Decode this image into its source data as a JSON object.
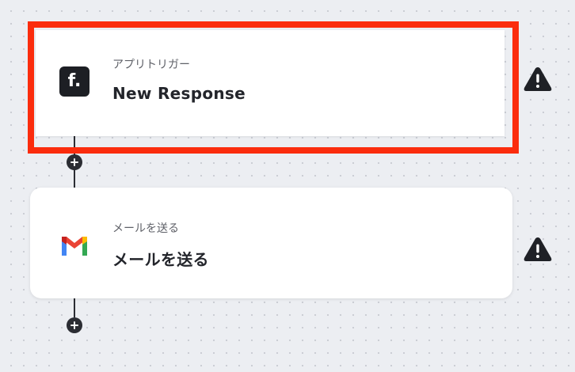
{
  "flow": {
    "steps": [
      {
        "icon": "formbricks-icon",
        "sublabel": "アプリトリガー",
        "title": "New Response",
        "selected": true,
        "warning": true
      },
      {
        "icon": "gmail-icon",
        "sublabel": "メールを送る",
        "title": "メールを送る",
        "selected": false,
        "warning": true
      }
    ],
    "formbricks_glyph": "f."
  },
  "colors": {
    "canvas_bg": "#eceef2",
    "highlight": "#fb2c0d",
    "connector": "#2b2d33",
    "warning": "#1f2126",
    "gmail_red": "#ea4335",
    "gmail_blue": "#4285f4",
    "gmail_green": "#34a853",
    "gmail_yellow": "#fbbc04"
  }
}
